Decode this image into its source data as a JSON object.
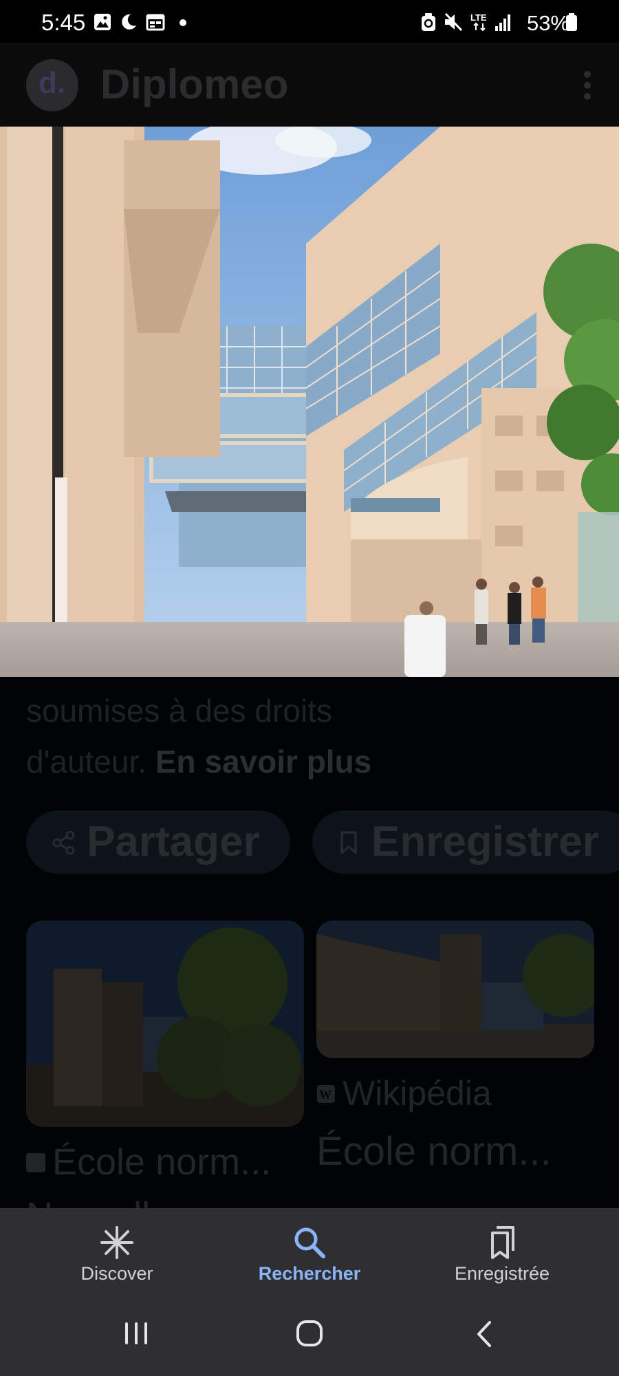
{
  "status_bar": {
    "time": "5:45",
    "battery": "53%",
    "network": "LTE",
    "icons": [
      "gallery-icon",
      "moon-icon",
      "calendar-icon",
      "dot-icon",
      "recycle-icon",
      "mute-icon",
      "lte-icon",
      "signal-icon",
      "battery-icon"
    ]
  },
  "app_bar": {
    "logo_letter": "d.",
    "title": "Diplomeo",
    "menu_icon": "more-vert-icon"
  },
  "hero_image": {
    "description_icon": "building-photo"
  },
  "caption": {
    "line1": "soumises à des droits",
    "line2_prefix": "d'auteur. ",
    "link": "En savoir plus"
  },
  "actions": {
    "share_label": "Partager",
    "save_label": "Enregistrer"
  },
  "results": [
    {
      "source": "",
      "title": "École norm...",
      "subtitle": "Nouvelle..."
    },
    {
      "source": "Wikipédia",
      "title": "École norm..."
    }
  ],
  "bottom_nav": {
    "items": [
      {
        "label": "Discover",
        "icon": "asterisk-icon",
        "active": false
      },
      {
        "label": "Rechercher",
        "icon": "search-icon",
        "active": true
      },
      {
        "label": "Enregistrée",
        "icon": "bookmarks-icon",
        "active": false
      }
    ]
  },
  "colors": {
    "accent": "#8ab4f8",
    "nav_bg": "#2f2f31",
    "overlay": "#020304"
  }
}
